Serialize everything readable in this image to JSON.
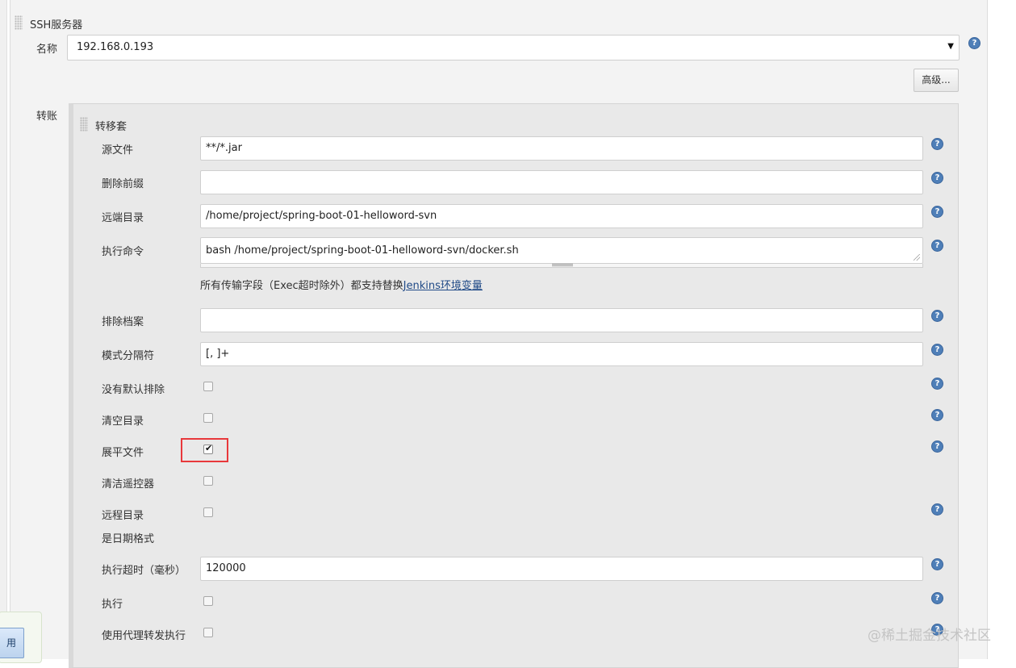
{
  "ssh_server": {
    "section_title": "SSH服务器",
    "name_label": "名称",
    "name_value": "192.168.0.193",
    "advanced_button": "高级..."
  },
  "transfers": {
    "label": "转账",
    "set_title": "转移套",
    "source_files": {
      "label": "源文件",
      "value": "**/*.jar"
    },
    "remove_prefix": {
      "label": "删除前缀",
      "value": ""
    },
    "remote_directory": {
      "label": "远端目录",
      "value": "/home/project/spring-boot-01-helloword-svn"
    },
    "exec_command": {
      "label": "执行命令",
      "value": "bash /home/project/spring-boot-01-helloword-svn/docker.sh"
    },
    "info_text": "所有传输字段（Exec超时除外）都支持替换",
    "info_link": "Jenkins环境变量",
    "exclude_files": {
      "label": "排除档案",
      "value": ""
    },
    "pattern_separator": {
      "label": "模式分隔符",
      "value": "[, ]+"
    },
    "no_default_excludes": {
      "label": "没有默认排除",
      "checked": false
    },
    "clean_remote": {
      "label": "清空目录",
      "checked": false
    },
    "flatten_files": {
      "label": "展平文件",
      "checked": true
    },
    "clean_remote_ctrl": {
      "label": "清洁遥控器",
      "checked": false
    },
    "remote_dir_date": {
      "label_line1": "远程目录",
      "label_line2": "是日期格式",
      "checked": false
    },
    "exec_timeout": {
      "label": "执行超时（毫秒）",
      "value": "120000"
    },
    "exec_in_pty": {
      "label": "执行",
      "checked": false
    },
    "exec_via_proxy": {
      "label": "使用代理转发执行",
      "checked": false
    }
  },
  "footer": {
    "apply_button": "用",
    "watermark": "@稀土掘金技术社区"
  },
  "icons": {
    "help": "?",
    "dropdown": "▼",
    "check": "✔"
  },
  "colors": {
    "help_icon": "#4f7fb8",
    "highlight_border": "#e8383b",
    "link": "#204a87"
  }
}
